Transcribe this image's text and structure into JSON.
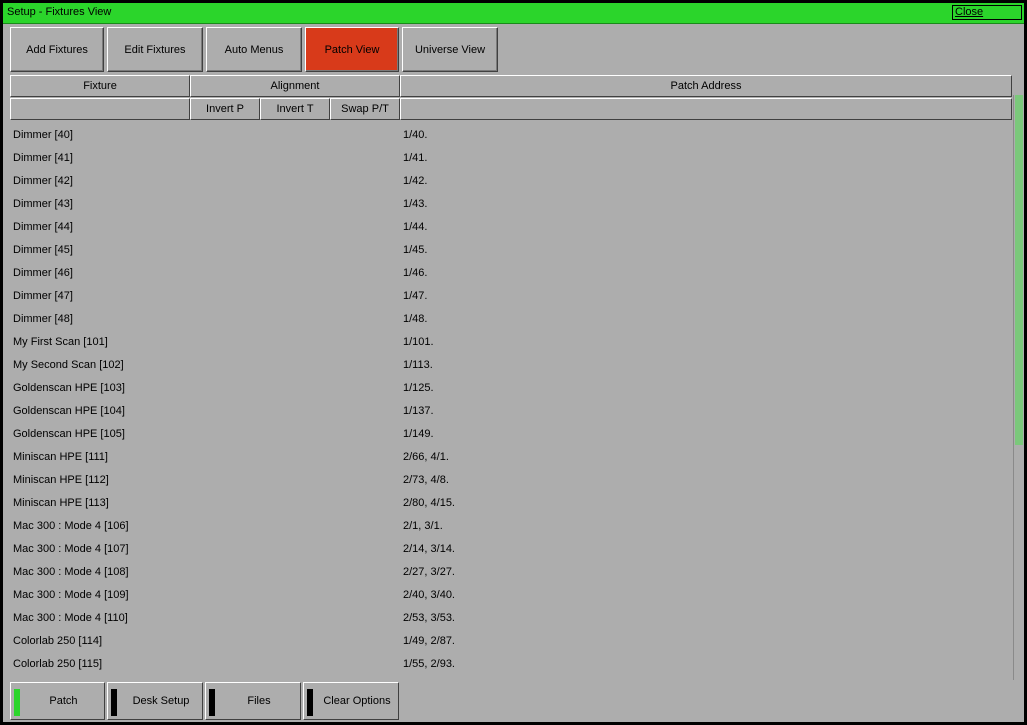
{
  "window": {
    "title": "Setup - Fixtures View",
    "close_label": "Close"
  },
  "tabs": [
    {
      "label": "Add Fixtures"
    },
    {
      "label": "Edit Fixtures"
    },
    {
      "label": "Auto Menus"
    },
    {
      "label": "Patch View",
      "active": true
    },
    {
      "label": "Universe View"
    }
  ],
  "columns": {
    "fixture": "Fixture",
    "alignment": "Alignment",
    "patch_address": "Patch Address",
    "invert_p": "Invert P",
    "invert_t": "Invert T",
    "swap_pt": "Swap P/T"
  },
  "rows": [
    {
      "fixture": "Dimmer [40]",
      "patch": "1/40."
    },
    {
      "fixture": "Dimmer [41]",
      "patch": "1/41."
    },
    {
      "fixture": "Dimmer [42]",
      "patch": "1/42."
    },
    {
      "fixture": "Dimmer [43]",
      "patch": "1/43."
    },
    {
      "fixture": "Dimmer [44]",
      "patch": "1/44."
    },
    {
      "fixture": "Dimmer [45]",
      "patch": "1/45."
    },
    {
      "fixture": "Dimmer [46]",
      "patch": "1/46."
    },
    {
      "fixture": "Dimmer [47]",
      "patch": "1/47."
    },
    {
      "fixture": "Dimmer [48]",
      "patch": "1/48."
    },
    {
      "fixture": "My First Scan [101]",
      "patch": "1/101."
    },
    {
      "fixture": "My Second Scan [102]",
      "patch": "1/113."
    },
    {
      "fixture": "Goldenscan HPE [103]",
      "patch": "1/125."
    },
    {
      "fixture": "Goldenscan HPE [104]",
      "patch": "1/137."
    },
    {
      "fixture": "Goldenscan HPE [105]",
      "patch": "1/149."
    },
    {
      "fixture": "Miniscan HPE [111]",
      "patch": "2/66, 4/1."
    },
    {
      "fixture": "Miniscan HPE [112]",
      "patch": "2/73, 4/8."
    },
    {
      "fixture": "Miniscan HPE [113]",
      "patch": "2/80, 4/15."
    },
    {
      "fixture": "Mac 300 : Mode 4 [106]",
      "patch": "2/1, 3/1."
    },
    {
      "fixture": "Mac 300 : Mode 4 [107]",
      "patch": "2/14, 3/14."
    },
    {
      "fixture": "Mac 300 : Mode 4 [108]",
      "patch": "2/27, 3/27."
    },
    {
      "fixture": "Mac 300 : Mode 4 [109]",
      "patch": "2/40, 3/40."
    },
    {
      "fixture": "Mac 300 : Mode 4 [110]",
      "patch": "2/53, 3/53."
    },
    {
      "fixture": "Colorlab 250 [114]",
      "patch": "1/49, 2/87."
    },
    {
      "fixture": "Colorlab 250 [115]",
      "patch": "1/55, 2/93."
    }
  ],
  "bottom_buttons": [
    {
      "label": "Patch",
      "indicator": "green"
    },
    {
      "label": "Desk Setup",
      "indicator": "black"
    },
    {
      "label": "Files",
      "indicator": "black"
    },
    {
      "label": "Clear Options",
      "indicator": "black"
    }
  ],
  "colors": {
    "titlebar": "#2bd52b",
    "active_tab": "#d83a1a",
    "background": "#adadad"
  }
}
